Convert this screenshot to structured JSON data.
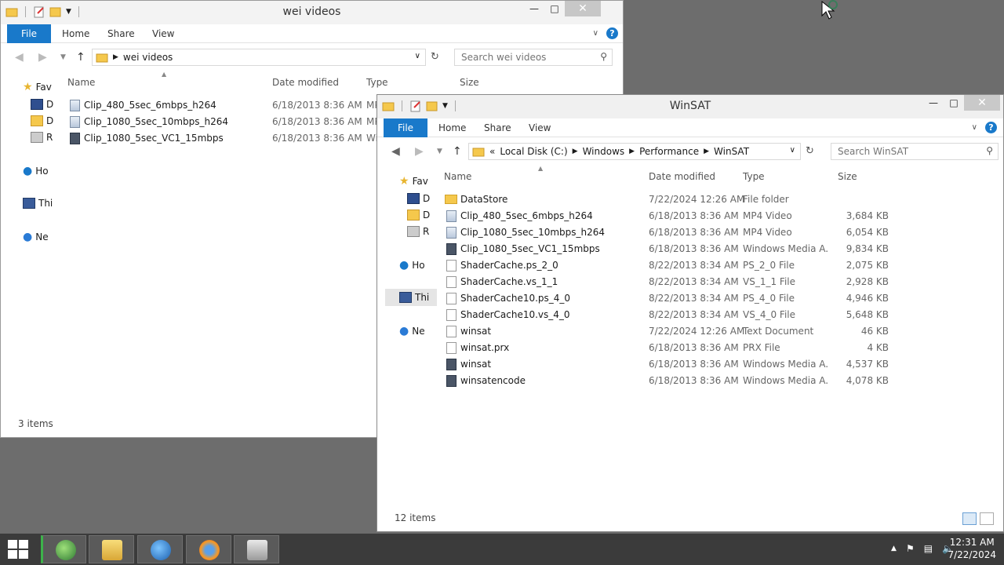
{
  "colors": {
    "accent": "#1979ca",
    "desktop": "#6d6d6d",
    "taskbar": "#3b3b3b"
  },
  "window_back": {
    "title": "wei videos",
    "ribbon": {
      "file": "File",
      "home": "Home",
      "share": "Share",
      "view": "View"
    },
    "address": {
      "crumbs": [
        "wei videos"
      ]
    },
    "search_placeholder": "Search wei videos",
    "nav": [
      "Fav",
      "D",
      "D",
      "R",
      "Ho",
      "Thi",
      "Ne"
    ],
    "columns": {
      "name": "Name",
      "date": "Date modified",
      "type": "Type",
      "size": "Size"
    },
    "rows": [
      {
        "name": "Clip_480_5sec_6mbps_h264",
        "date": "6/18/2013 8:36 AM",
        "type": "MP"
      },
      {
        "name": "Clip_1080_5sec_10mbps_h264",
        "date": "6/18/2013 8:36 AM",
        "type": "MP"
      },
      {
        "name": "Clip_1080_5sec_VC1_15mbps",
        "date": "6/18/2013 8:36 AM",
        "type": "Wi"
      }
    ],
    "status": "3 items"
  },
  "window_front": {
    "title": "WinSAT",
    "ribbon": {
      "file": "File",
      "home": "Home",
      "share": "Share",
      "view": "View"
    },
    "address": {
      "overflow": "«",
      "crumbs": [
        "Local Disk (C:)",
        "Windows",
        "Performance",
        "WinSAT"
      ]
    },
    "search_placeholder": "Search WinSAT",
    "nav": [
      "Fav",
      "D",
      "D",
      "R",
      "Ho",
      "Thi",
      "Ne"
    ],
    "columns": {
      "name": "Name",
      "date": "Date modified",
      "type": "Type",
      "size": "Size"
    },
    "rows": [
      {
        "icon": "folder",
        "name": "DataStore",
        "date": "7/22/2024 12:26 AM",
        "type": "File folder",
        "size": ""
      },
      {
        "icon": "video",
        "name": "Clip_480_5sec_6mbps_h264",
        "date": "6/18/2013 8:36 AM",
        "type": "MP4 Video",
        "size": "3,684 KB"
      },
      {
        "icon": "video",
        "name": "Clip_1080_5sec_10mbps_h264",
        "date": "6/18/2013 8:36 AM",
        "type": "MP4 Video",
        "size": "6,054 KB"
      },
      {
        "icon": "media",
        "name": "Clip_1080_5sec_VC1_15mbps",
        "date": "6/18/2013 8:36 AM",
        "type": "Windows Media A...",
        "size": "9,834 KB"
      },
      {
        "icon": "doc",
        "name": "ShaderCache.ps_2_0",
        "date": "8/22/2013 8:34 AM",
        "type": "PS_2_0 File",
        "size": "2,075 KB"
      },
      {
        "icon": "doc",
        "name": "ShaderCache.vs_1_1",
        "date": "8/22/2013 8:34 AM",
        "type": "VS_1_1 File",
        "size": "2,928 KB"
      },
      {
        "icon": "doc",
        "name": "ShaderCache10.ps_4_0",
        "date": "8/22/2013 8:34 AM",
        "type": "PS_4_0 File",
        "size": "4,946 KB"
      },
      {
        "icon": "doc",
        "name": "ShaderCache10.vs_4_0",
        "date": "8/22/2013 8:34 AM",
        "type": "VS_4_0 File",
        "size": "5,648 KB"
      },
      {
        "icon": "doc",
        "name": "winsat",
        "date": "7/22/2024 12:26 AM",
        "type": "Text Document",
        "size": "46 KB"
      },
      {
        "icon": "doc",
        "name": "winsat.prx",
        "date": "6/18/2013 8:36 AM",
        "type": "PRX File",
        "size": "4 KB"
      },
      {
        "icon": "media",
        "name": "winsat",
        "date": "6/18/2013 8:36 AM",
        "type": "Windows Media A...",
        "size": "4,537 KB"
      },
      {
        "icon": "media",
        "name": "winsatencode",
        "date": "6/18/2013 8:36 AM",
        "type": "Windows Media A...",
        "size": "4,078 KB"
      }
    ],
    "status": "12 items"
  },
  "taskbar": {
    "buttons": [
      "ie-icon",
      "file-explorer-icon",
      "network-icon",
      "firefox-icon",
      "app-icon"
    ],
    "clock_time": "12:31 AM",
    "clock_date": "7/22/2024"
  }
}
